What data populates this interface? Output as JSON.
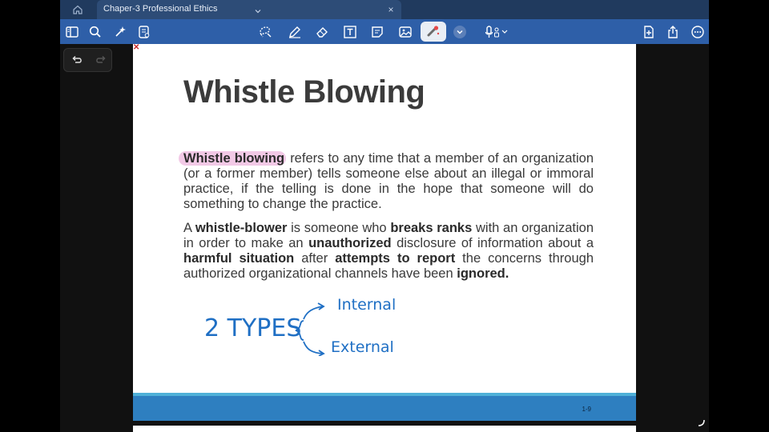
{
  "tab": {
    "title": "Chaper-3 Professional Ethics",
    "close": "×"
  },
  "toolbar": {
    "icons": [
      "sidebar-icon",
      "search-icon",
      "bookmark-add-icon",
      "document-settings-icon",
      "lasso-icon",
      "pen-icon",
      "eraser-icon",
      "text-box-icon",
      "sticky-note-icon",
      "image-icon",
      "laser-pointer-icon",
      "chevron-down-icon",
      "microphone-icon",
      "add-page-icon",
      "share-icon",
      "more-icon"
    ]
  },
  "slide": {
    "title": "Whistle Blowing",
    "p1": {
      "highlight": "Whistle blowing",
      "rest": " refers to any time that a member of an organization (or a former member) tells someone else about an illegal or immoral practice, if the telling is done in the hope that someone will do something to change the practice."
    },
    "p2": {
      "s1": "A ",
      "b1": "whistle-blower",
      "s2": " is someone who ",
      "b2": "breaks ranks",
      "s3": " with an organization in order to make an ",
      "b3": "unauthorized",
      "s4": " disclosure of information about a ",
      "b4": "harmful situation",
      "s5": " after ",
      "b5": "attempts to report",
      "s6": " the concerns through authorized organizational channels have been ",
      "b6": "ignored."
    },
    "handwriting": {
      "left": "2 TYPES",
      "top": "Internal",
      "bottom": "External"
    },
    "page_number": "1-9"
  },
  "colors": {
    "tabbar": "#203a5e",
    "toolbar": "#2e5fa8",
    "highlight": "#f2c9e6",
    "ink": "#1f6fc4",
    "footer": "#2e7fc0"
  }
}
